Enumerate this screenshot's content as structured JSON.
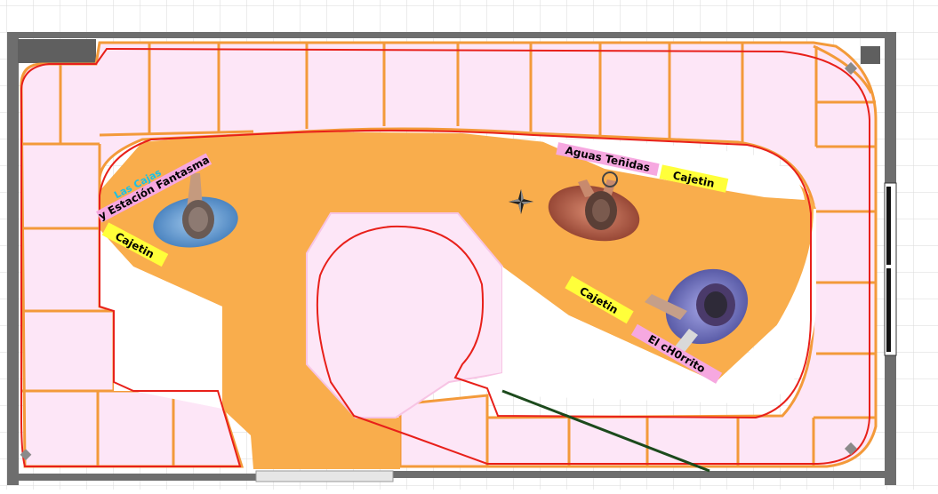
{
  "labels": {
    "las_cajas": "Las Cajas",
    "estacion_fantasma": "y Estación Fantasma",
    "aguas_tenidas": "Aguas  Teñidas",
    "el_chorrito": "El cH0rrito",
    "cajetin_1": "Cajetin",
    "cajetin_2": "Cajetin",
    "cajetin_3": "Cajetin"
  },
  "colors": {
    "room_wall": "#6e6e6e",
    "benchwork_edge": "#f39a3a",
    "benchwork_fill": "#fde6f7",
    "operating_area": "#f9ad4c",
    "track": "#e8201a",
    "pink_tag": "#f6a8e0",
    "yellow_tag": "#ffff3a",
    "cyan_text": "#19c1e6",
    "rail_line": "#1c4a1c",
    "grid_line": "#dadada"
  },
  "icons": [
    "compass-star-icon",
    "operator-figure-icon"
  ]
}
